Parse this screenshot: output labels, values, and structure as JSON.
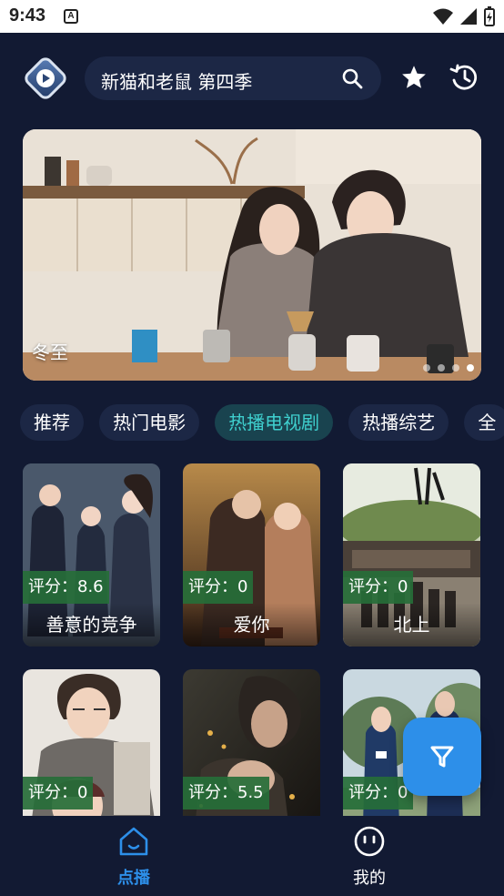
{
  "status_bar": {
    "time": "9:43",
    "notif_badge": "A"
  },
  "header": {
    "search_text": "新猫和老鼠 第四季",
    "icons": [
      "app-logo",
      "search-icon",
      "star-icon",
      "history-icon"
    ]
  },
  "banner": {
    "title": "冬至",
    "dots": 4,
    "active_dot": 4
  },
  "categories": [
    "推荐",
    "热门电影",
    "热播电视剧",
    "热播综艺",
    "全"
  ],
  "active_category": "热播电视剧",
  "cards": [
    {
      "rating": "评分：8.6",
      "title": "善意的竞争"
    },
    {
      "rating": "评分：0",
      "title": "爱你"
    },
    {
      "rating": "评分：0",
      "title": "北上"
    },
    {
      "rating": "评分：0",
      "title": ""
    },
    {
      "rating": "评分：5.5",
      "title": ""
    },
    {
      "rating": "评分：0",
      "title": ""
    }
  ],
  "nav": {
    "home": "点播",
    "me": "我的"
  },
  "colors": {
    "background": "#121a33",
    "accent": "#2d8fe9",
    "active_tab": "#3fd0cf",
    "rating_bg": "#266e38"
  }
}
